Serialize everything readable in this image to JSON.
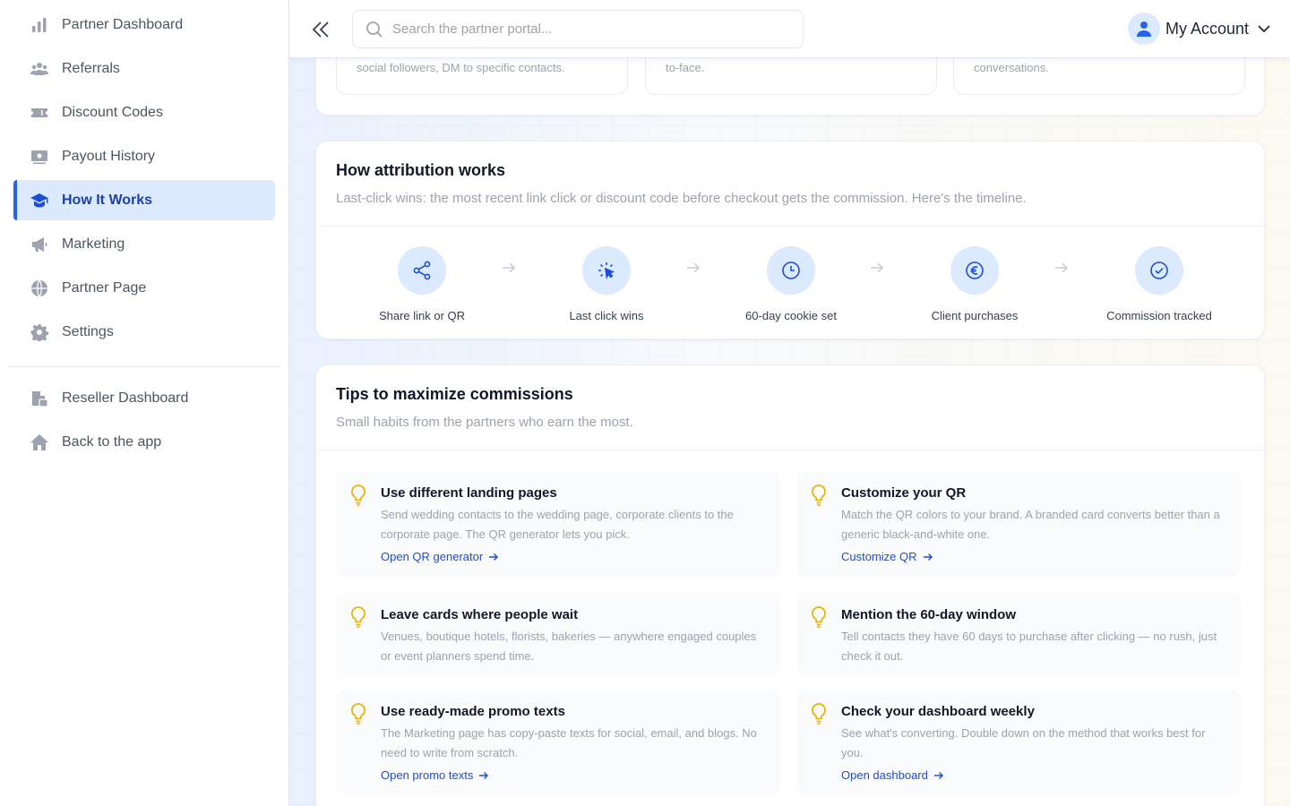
{
  "sidebar": {
    "items": [
      {
        "label": "Partner Dashboard",
        "icon": "bar-chart-icon"
      },
      {
        "label": "Referrals",
        "icon": "users-icon"
      },
      {
        "label": "Discount Codes",
        "icon": "ticket-icon"
      },
      {
        "label": "Payout History",
        "icon": "money-bill-icon"
      },
      {
        "label": "How It Works",
        "icon": "graduation-cap-icon",
        "active": true
      },
      {
        "label": "Marketing",
        "icon": "megaphone-icon"
      },
      {
        "label": "Partner Page",
        "icon": "globe-icon"
      },
      {
        "label": "Settings",
        "icon": "gear-icon"
      }
    ],
    "secondary": [
      {
        "label": "Reseller Dashboard",
        "icon": "reseller-chart-icon"
      },
      {
        "label": "Back to the app",
        "icon": "home-icon"
      }
    ]
  },
  "header": {
    "search_placeholder": "Search the partner portal...",
    "account_label": "My Account"
  },
  "top_cards": {
    "items": [
      {
        "text": "social followers, DM to specific contacts."
      },
      {
        "text": "to-face."
      },
      {
        "text": "conversations."
      }
    ]
  },
  "attribution": {
    "title": "How attribution works",
    "subtitle": "Last-click wins: the most recent link click or discount code before checkout gets the commission. Here's the timeline.",
    "steps": [
      {
        "label": "Share link or QR",
        "icon": "share-icon"
      },
      {
        "label": "Last click wins",
        "icon": "cursor-click-icon"
      },
      {
        "label": "60-day cookie set",
        "icon": "clock-icon"
      },
      {
        "label": "Client purchases",
        "icon": "euro-icon"
      },
      {
        "label": "Commission tracked",
        "icon": "check-circle-icon"
      }
    ]
  },
  "tips": {
    "title": "Tips to maximize commissions",
    "subtitle": "Small habits from the partners who earn the most.",
    "items": [
      {
        "title": "Use different landing pages",
        "desc": "Send wedding contacts to the wedding page, corporate clients to the corporate page. The QR generator lets you pick.",
        "link": "Open QR generator"
      },
      {
        "title": "Customize your QR",
        "desc": "Match the QR colors to your brand. A branded card converts better than a generic black-and-white one.",
        "link": "Customize QR"
      },
      {
        "title": "Leave cards where people wait",
        "desc": "Venues, boutique hotels, florists, bakeries — anywhere engaged couples or event planners spend time.",
        "link": ""
      },
      {
        "title": "Mention the 60-day window",
        "desc": "Tell contacts they have 60 days to purchase after clicking — no rush, just check it out.",
        "link": ""
      },
      {
        "title": "Use ready-made promo texts",
        "desc": "The Marketing page has copy-paste texts for social, email, and blogs. No need to write from scratch.",
        "link": "Open promo texts"
      },
      {
        "title": "Check your dashboard weekly",
        "desc": "See what's converting. Double down on the method that works best for you.",
        "link": "Open dashboard"
      }
    ]
  },
  "colors": {
    "accent": "#2563eb",
    "active_bg": "#dbeafe",
    "bulb": "#eab308"
  }
}
